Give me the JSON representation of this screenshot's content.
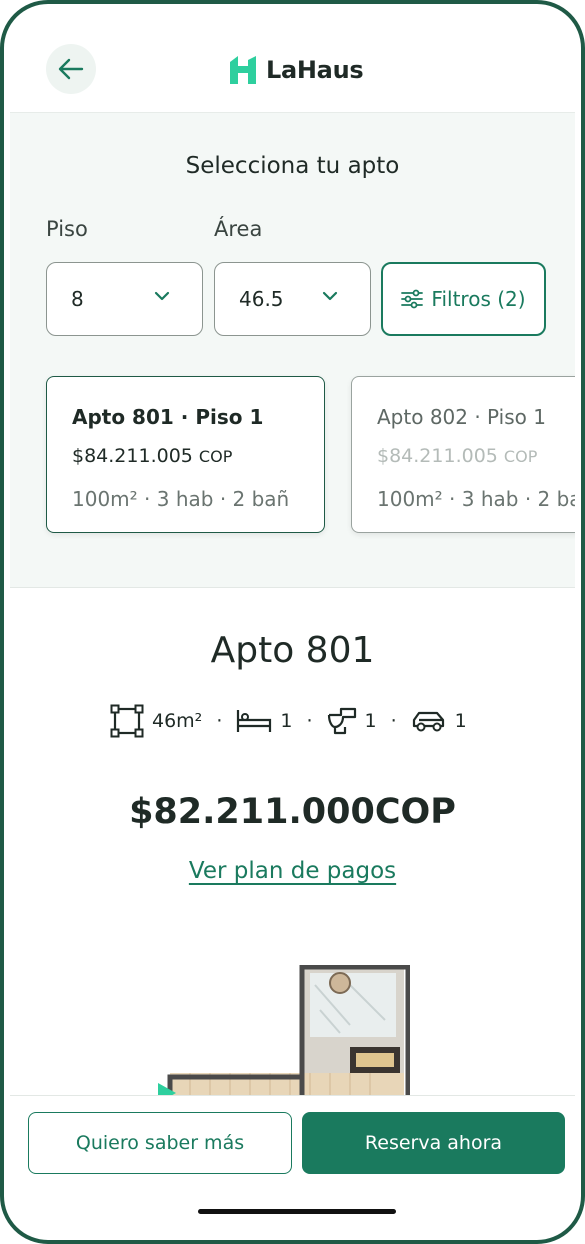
{
  "header": {
    "brand_name": "LaHaus",
    "back_icon": "arrow-left-icon",
    "logo_icon": "house-logo-icon"
  },
  "selector": {
    "title": "Selecciona tu apto",
    "floor_label": "Piso",
    "floor_value": "8",
    "area_label": "Área",
    "area_value": "46.5",
    "filters_label": "Filtros (2)"
  },
  "cards": [
    {
      "title": "Apto 801 · Piso 1",
      "price": "$84.211.005",
      "currency": "COP",
      "features": "100m² · 3 hab · 2 bañ",
      "selected": true
    },
    {
      "title": "Apto 802 · Piso 1",
      "price": "$84.211.005",
      "currency": "COP",
      "features": "100m² · 3 hab · 2 ba",
      "selected": false
    }
  ],
  "detail": {
    "title": "Apto 801",
    "area": "46m²",
    "bedrooms": "1",
    "bathrooms": "1",
    "parking": "1",
    "price": "$82.211.000COP",
    "payment_plan_link": "Ver plan de pagos"
  },
  "actions": {
    "more_info": "Quiero saber más",
    "reserve": "Reserva ahora"
  },
  "colors": {
    "brand_green": "#1a7a5e",
    "frame": "#1f5a46",
    "logo_teal": "#2ecf9e"
  }
}
